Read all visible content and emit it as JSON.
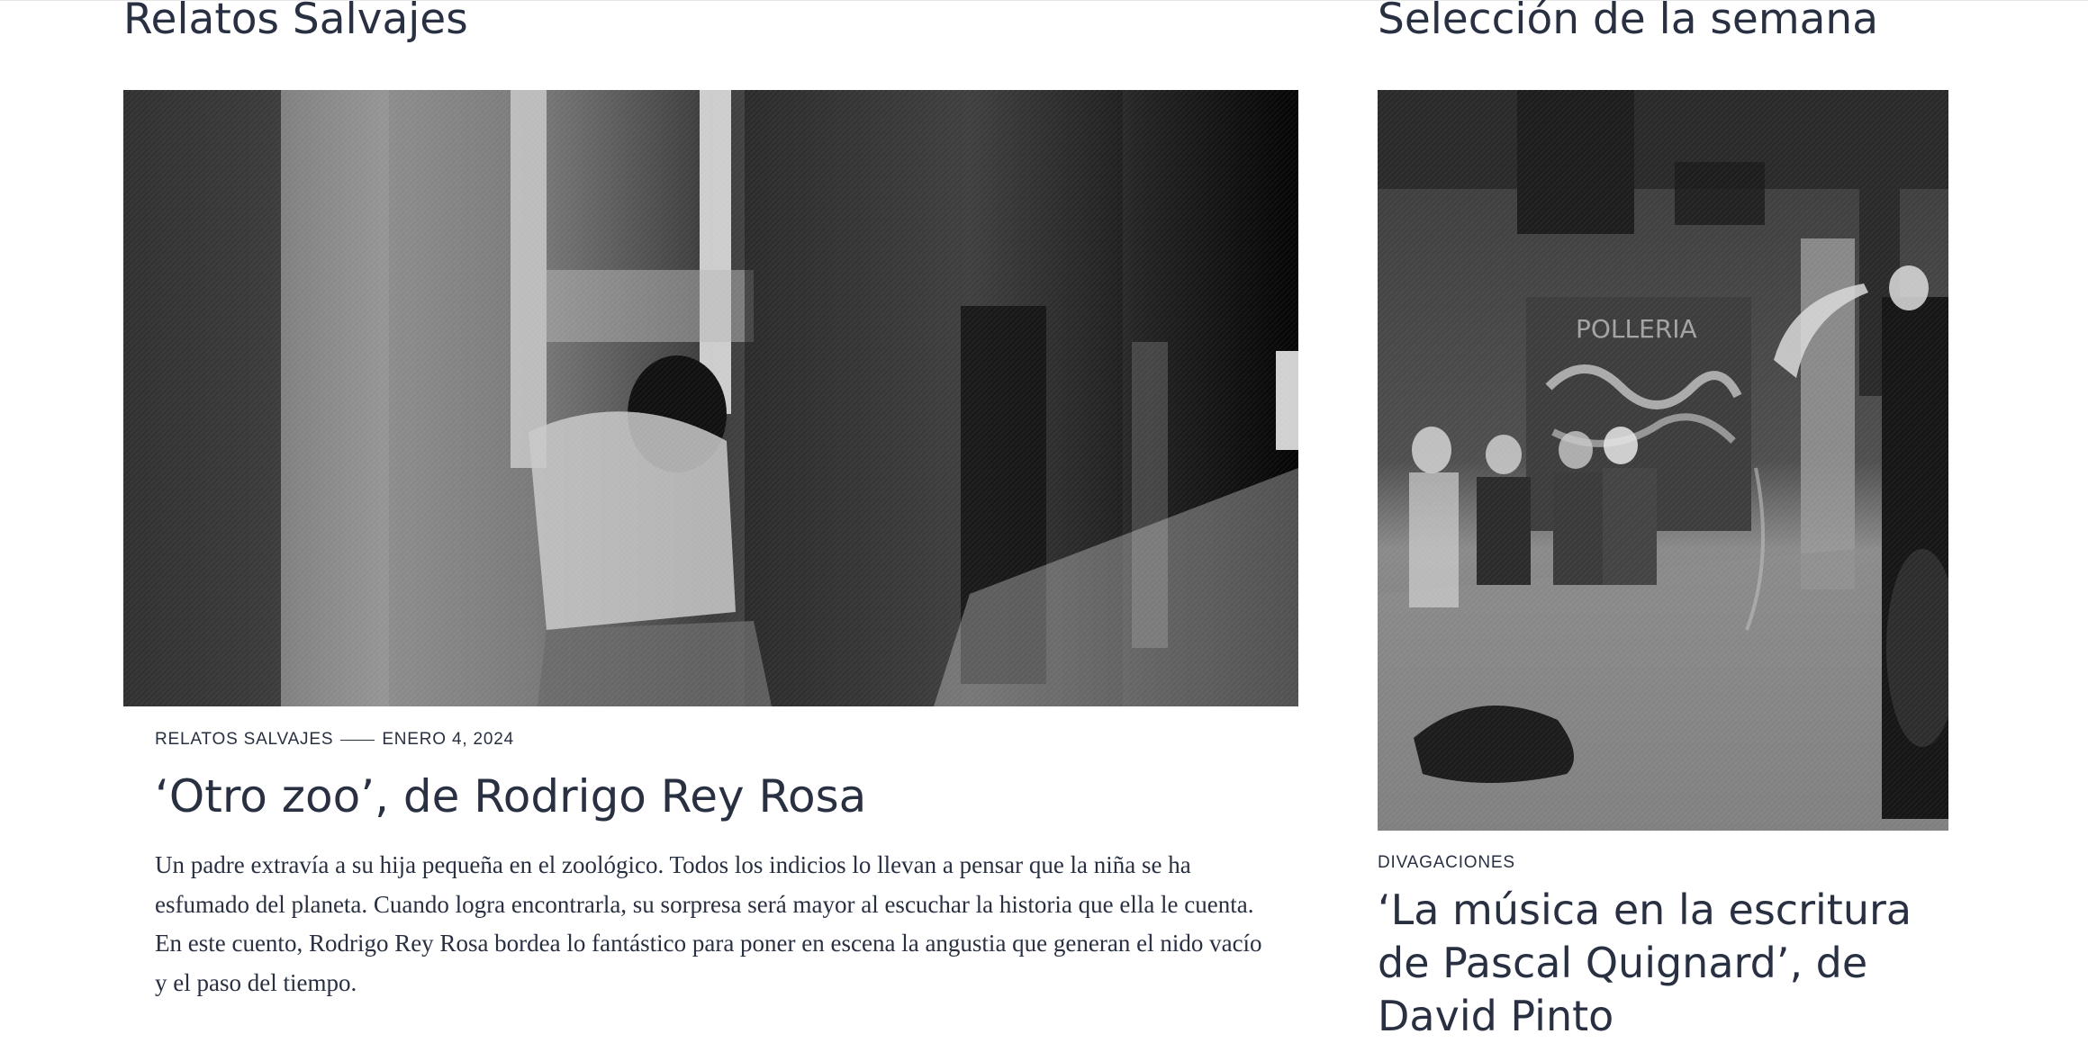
{
  "left_section": {
    "title": "Relatos Salvajes",
    "article": {
      "category": "RELATOS SALVAJES",
      "date": "ENERO 4, 2024",
      "headline": "‘Otro zoo’, de Rodrigo Rey Rosa",
      "excerpt": "Un padre extravía a su hija pequeña en el zoológico. Todos los indicios lo llevan a pensar que la niña se ha esfumado del planeta. Cuando logra encontrarla, su sorpresa será mayor al escuchar la historia que ella le cuenta. En este cuento, Rodrigo Rey Rosa bordea lo fantástico para poner en escena la angustia que generan el nido vacío y el paso del tiempo.",
      "image": "black-and-white-street-night-photo"
    }
  },
  "right_section": {
    "title": "Selección de la semana",
    "article": {
      "category": "DIVAGACIONES",
      "headline": "‘La música en la escritura de Pascal Quignard’, de David Pinto",
      "image": "black-and-white-saxophone-street-photo"
    }
  },
  "colors": {
    "text": "#283042",
    "background": "#ffffff"
  }
}
